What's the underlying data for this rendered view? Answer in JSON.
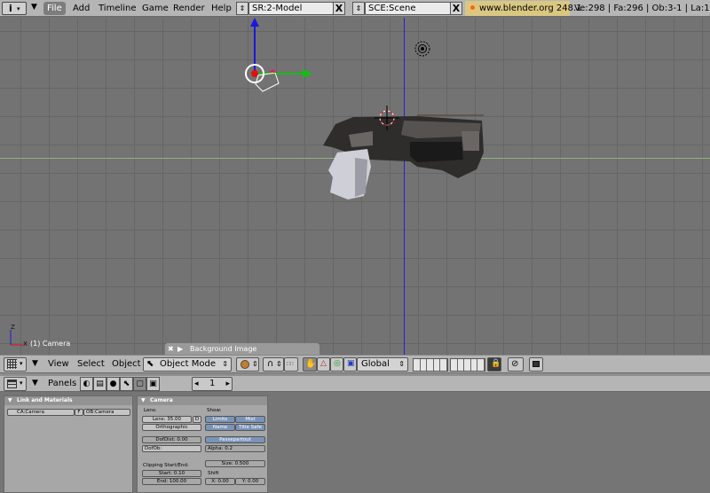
{
  "top_menu": {
    "items": [
      "File",
      "Add",
      "Timeline",
      "Game",
      "Render",
      "Help"
    ],
    "screen_field": "SR:2-Model",
    "scene_field": "SCE:Scene",
    "close_glyph": "X",
    "website": "www.blender.org 248.1",
    "stats": "Ve:298 | Fa:296 | Ob:3-1 | La:1"
  },
  "viewport": {
    "object_label": "(1) Camera",
    "axis_x_label": "X",
    "axis_z_label": "Z",
    "bg_panel_title": "Background Image",
    "colors": {
      "x_axis": "#8fb37c",
      "y_axis": "#2020e0",
      "z_axis": "#20c020",
      "grid": "#666666",
      "background": "#737373"
    }
  },
  "header3d": {
    "menus": [
      "View",
      "Select",
      "Object"
    ],
    "mode": "Object Mode",
    "orientation": "Global"
  },
  "buttons_header": {
    "panels_label": "Panels",
    "frame_value": "1",
    "prev_arrow": "◂",
    "next_arrow": "▸"
  },
  "panel_link": {
    "title": "Link and Materials",
    "ca_field": "CA:Camera",
    "f_button": "F",
    "ob_field": "OB:Camera"
  },
  "panel_camera": {
    "title": "Camera",
    "lens_label": "Lens:",
    "lens_value": "Lens: 35.00",
    "d_button": "D",
    "ortho_button": "Orthographic",
    "dof_dist": "DofDist: 0.00",
    "dof_ob": "DofOb:",
    "clipping_label": "Clipping Start/End:",
    "clip_start": "Start: 0.10",
    "clip_end": "End: 100.00",
    "show_label": "Show:",
    "limits": "Limits",
    "mist": "Mist",
    "name": "Name",
    "title_safe": "Title Safe",
    "passepartout": "Passepartout",
    "alpha": "Alpha: 0.2",
    "size": "Size: 0.500",
    "shift_label": "Shift",
    "shift_x": "X: 0.00",
    "shift_y": "Y: 0.00"
  }
}
